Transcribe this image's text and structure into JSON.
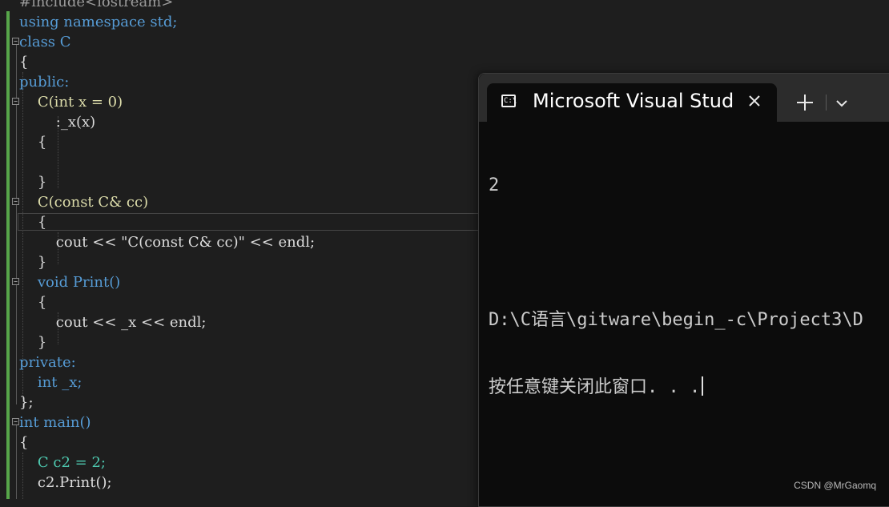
{
  "editor": {
    "lines": [
      "#include<iostream>",
      "using namespace std;",
      "class C",
      "{",
      "public:",
      "    C(int x = 0)",
      "        :_x(x)",
      "    {",
      "",
      "    }",
      "    C(const C& cc)",
      "    {",
      "        cout << \"C(const C& cc)\" << endl;",
      "    }",
      "    void Print()",
      "    {",
      "        cout << _x << endl;",
      "    }",
      "private:",
      "    int _x;",
      "};",
      "int main()",
      "{",
      "    C c2 = 2;",
      "    c2.Print();"
    ],
    "colors": {
      "keyword": "#569cd6",
      "type": "#4ec9b0",
      "function": "#dcdcaa",
      "string": "#d69d85",
      "number": "#b5cea8",
      "change_bar": "#57a64a"
    }
  },
  "terminal": {
    "tab_title": "Microsoft Visual Stud",
    "tab_icon": "console-icon",
    "close_icon": "close-icon",
    "new_tab_icon": "plus-icon",
    "dropdown_icon": "chevron-down-icon",
    "output": [
      "2",
      "",
      "D:\\C语言\\gitware\\begin_-c\\Project3\\D",
      "按任意键关闭此窗口. . ."
    ]
  },
  "watermark": "CSDN @MrGaomq"
}
